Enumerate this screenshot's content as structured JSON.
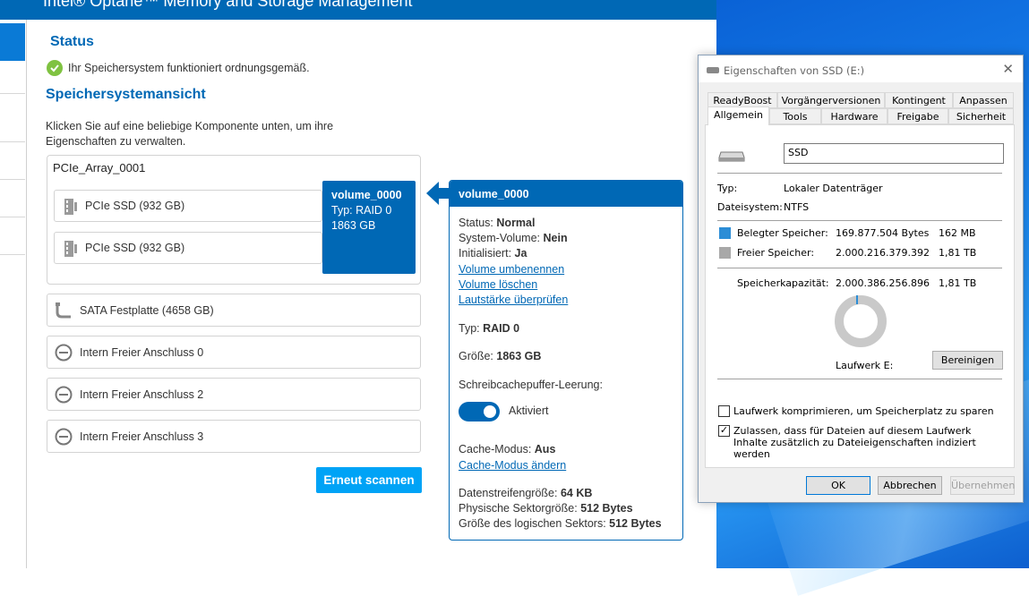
{
  "app": {
    "title": "Intel® Optane™ Memory and Storage Management",
    "status_heading": "Status",
    "status_text": "Ihr Speichersystem funktioniert ordnungsgemäß.",
    "view_heading": "Speichersystemansicht",
    "view_desc": "Klicken Sie auf eine beliebige Komponente unten, um ihre Eigenschaften zu verwalten.",
    "array": {
      "name": "PCIe_Array_0001",
      "disks": [
        "PCIe SSD (932 GB)",
        "PCIe SSD (932 GB)"
      ],
      "volume_tile": {
        "name": "volume_0000",
        "type": "Typ: RAID 0",
        "size": "1863 GB"
      }
    },
    "ports": [
      "SATA Festplatte (4658 GB)",
      "Intern Freier Anschluss 0",
      "Intern Freier Anschluss 2",
      "Intern Freier Anschluss 3"
    ],
    "rescan_label": "Erneut scannen",
    "panel": {
      "title": "volume_0000",
      "status_label": "Status:",
      "status_value": "Normal",
      "sysvol_label": "System-Volume:",
      "sysvol_value": "Nein",
      "init_label": "Initialisiert:",
      "init_value": "Ja",
      "link_rename": "Volume umbenennen",
      "link_delete": "Volume löschen",
      "link_check": "Lautstärke überprüfen",
      "type_label": "Typ:",
      "type_value": "RAID 0",
      "size_label": "Größe:",
      "size_value": "1863 GB",
      "cache_flush_label": "Schreibcachepuffer-Leerung:",
      "toggle_label": "Aktiviert",
      "cache_mode_label": "Cache-Modus:",
      "cache_mode_value": "Aus",
      "link_cache_mode": "Cache-Modus ändern",
      "stripe_label": "Datenstreifengröße:",
      "stripe_value": "64 KB",
      "phys_label": "Physische Sektorgröße:",
      "phys_value": "512 Bytes",
      "logical_label": "Größe des logischen Sektors:",
      "logical_value": "512 Bytes"
    }
  },
  "dialog": {
    "title": "Eigenschaften von SSD (E:)",
    "close": "✕",
    "tabs_row1": [
      "ReadyBoost",
      "Vorgängerversionen",
      "Kontingent",
      "Anpassen"
    ],
    "tabs_row2": [
      "Allgemein",
      "Tools",
      "Hardware",
      "Freigabe",
      "Sicherheit"
    ],
    "drive_name": "SSD",
    "type_label": "Typ:",
    "type_value": "Lokaler Datenträger",
    "fs_label": "Dateisystem:",
    "fs_value": "NTFS",
    "used_label": "Belegter Speicher:",
    "used_bytes": "169.877.504 Bytes",
    "used_short": "162 MB",
    "free_label": "Freier Speicher:",
    "free_bytes": "2.000.216.379.392",
    "free_short": "1,81 TB",
    "cap_label": "Speicherkapazität:",
    "cap_bytes": "2.000.386.256.896",
    "cap_short": "1,81 TB",
    "drive_label": "Laufwerk E:",
    "cleanup": "Bereinigen",
    "compress_label": "Laufwerk komprimieren, um Speicherplatz zu sparen",
    "index_label": "Zulassen, dass für Dateien auf diesem Laufwerk Inhalte zusätzlich zu Dateieigenschaften indiziert werden",
    "ok": "OK",
    "cancel": "Abbrechen",
    "apply": "Übernehmen",
    "colors": {
      "used": "#2b8dd6",
      "free": "#a8a8a8"
    }
  }
}
